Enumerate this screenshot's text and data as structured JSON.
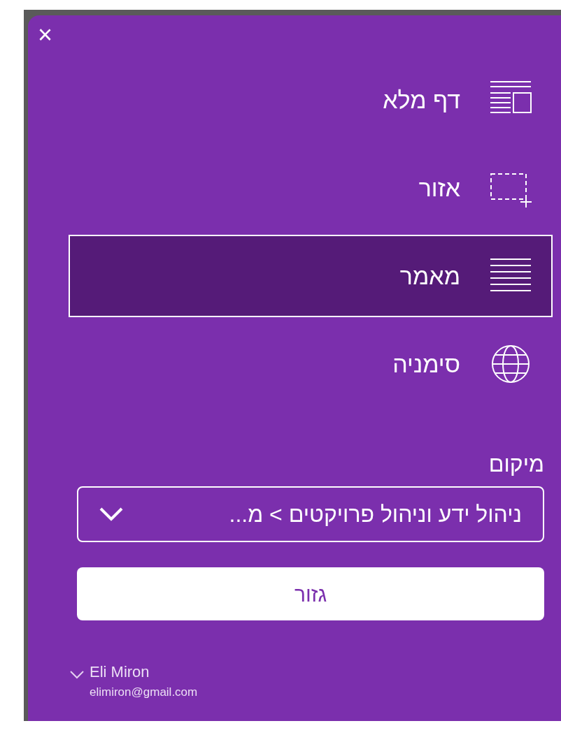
{
  "close_label": "×",
  "options": [
    {
      "kind": "full_page",
      "label": "דף מלא",
      "selected": false
    },
    {
      "kind": "region",
      "label": "אזור",
      "selected": false
    },
    {
      "kind": "article",
      "label": "מאמר",
      "selected": true
    },
    {
      "kind": "bookmark",
      "label": "סימניה",
      "selected": false
    }
  ],
  "location": {
    "label": "מיקום",
    "value": "ניהול ידע וניהול פרויקטים > מ..."
  },
  "clip_button": "גזור",
  "account": {
    "name": "Eli Miron",
    "email": "elimiron@gmail.com"
  }
}
